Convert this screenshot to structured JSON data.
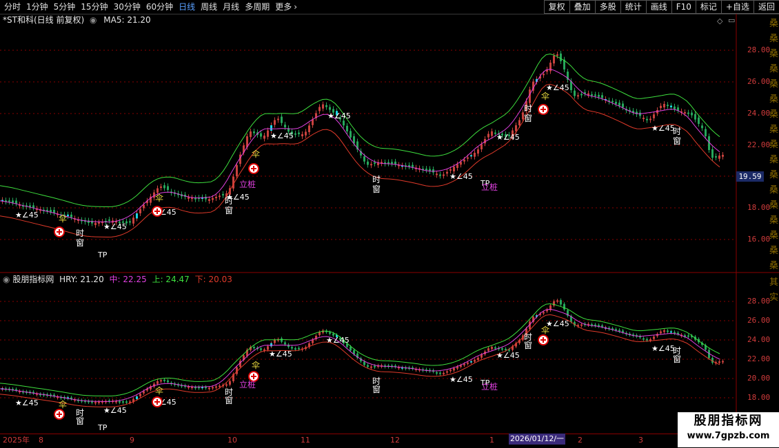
{
  "toolbar": {
    "periods": [
      "分时",
      "1分钟",
      "5分钟",
      "15分钟",
      "30分钟",
      "60分钟",
      "日线",
      "周线",
      "月线",
      "多周期",
      "更多"
    ],
    "active_period": "日线",
    "more_chevron": "more-chevron-icon",
    "tools": [
      "复权",
      "叠加",
      "多股",
      "统计",
      "画线",
      "F10",
      "标记",
      "+自选",
      "返回"
    ]
  },
  "main_panel": {
    "title": "*ST和科(日线 前复权)",
    "ma_label": "MA5: 21.20",
    "price_ticks": [
      "28.00",
      "26.00",
      "24.00",
      "22.00",
      "18.00",
      "16.00"
    ],
    "current_price": "19.59",
    "side_text": "桑桑桑桑桑桑桑桑桑桑桑桑桑桑桑桑桑桑"
  },
  "sub_panel": {
    "indicator_name": "股朋指标网",
    "hry": "HRY: 21.20",
    "mid": "中: 22.25",
    "up": "上: 24.47",
    "down": "下: 20.03",
    "price_ticks": [
      "28.00",
      "26.00",
      "24.00",
      "22.00",
      "20.00",
      "18.00"
    ],
    "side_text": "其实"
  },
  "time_axis": {
    "labels": [
      "2025年",
      "8",
      "9",
      "10",
      "11",
      "12",
      "1",
      "2",
      "3"
    ],
    "cursor_date": "2026/01/12/一"
  },
  "markers": {
    "star": "★∠45",
    "time_window_1": "时",
    "time_window_2": "窗",
    "umbrella": "伞",
    "tp": "TP",
    "pile": "立桩"
  },
  "watermark": {
    "title": "股朋指标网",
    "url": "www.7gpzb.com"
  },
  "colors": {
    "up": "#c8423e",
    "down": "#26a65b",
    "cyan": "#19d6e6",
    "upper_band": "#3ee03e",
    "mid_band": "#e040e0",
    "lower_band": "#e03a2a",
    "grid": "#8b0000"
  }
}
